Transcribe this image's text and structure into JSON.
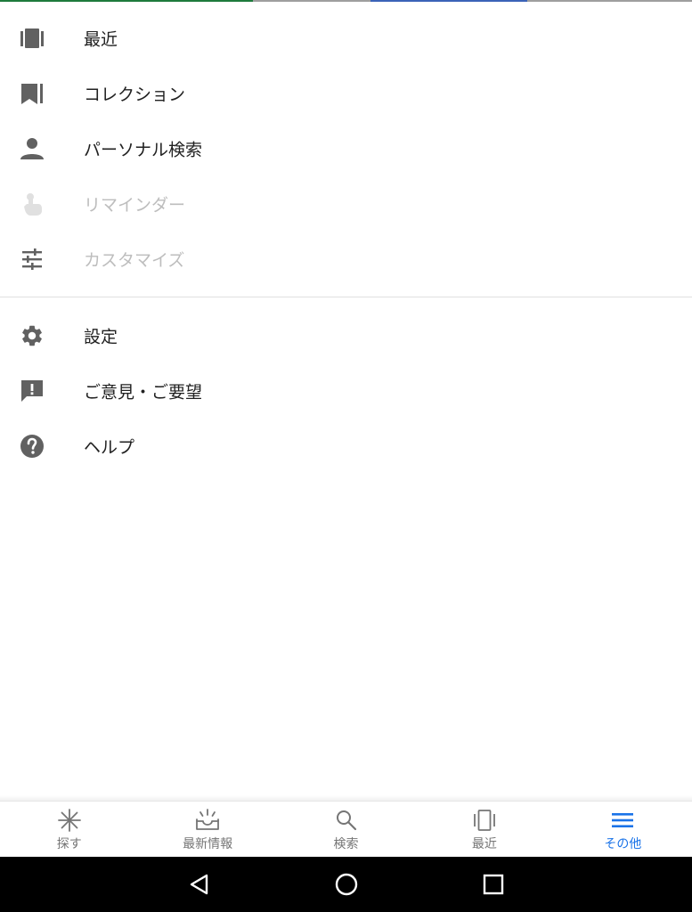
{
  "menu_primary": [
    {
      "label": "最近",
      "icon": "recent-icon",
      "enabled": true
    },
    {
      "label": "コレクション",
      "icon": "bookmark-icon",
      "enabled": true
    },
    {
      "label": "パーソナル検索",
      "icon": "person-icon",
      "enabled": true
    },
    {
      "label": "リマインダー",
      "icon": "touch-icon",
      "enabled": false
    },
    {
      "label": "カスタマイズ",
      "icon": "tune-icon",
      "enabled": false
    }
  ],
  "menu_secondary": [
    {
      "label": "設定",
      "icon": "gear-icon"
    },
    {
      "label": "ご意見・ご要望",
      "icon": "feedback-icon"
    },
    {
      "label": "ヘルプ",
      "icon": "help-icon"
    }
  ],
  "bottom_nav": [
    {
      "label": "探す",
      "icon": "asterisk-icon",
      "active": false
    },
    {
      "label": "最新情報",
      "icon": "inbox-icon",
      "active": false
    },
    {
      "label": "検索",
      "icon": "search-icon",
      "active": false
    },
    {
      "label": "最近",
      "icon": "recent-icon",
      "active": false
    },
    {
      "label": "その他",
      "icon": "menu-icon",
      "active": true
    }
  ],
  "system_nav": [
    "back-icon",
    "home-icon",
    "overview-icon"
  ],
  "colors": {
    "accent": "#1a73e8",
    "icon_gray": "#616161",
    "disabled": "#bdbdbd",
    "strip_green": "#1e7a3c",
    "strip_blue": "#3b63b8"
  }
}
